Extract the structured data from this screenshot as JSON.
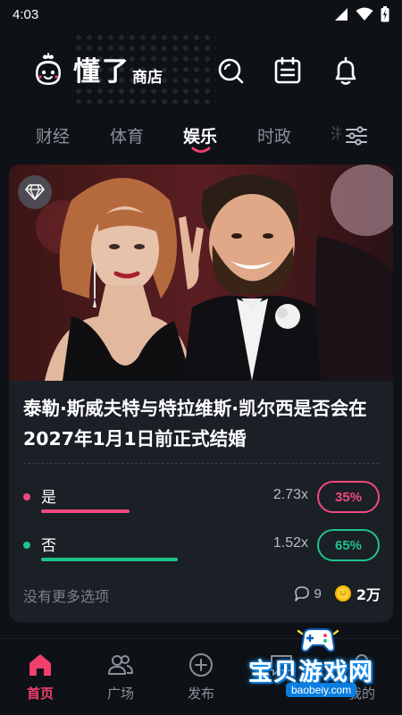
{
  "status_bar": {
    "time": "4:03"
  },
  "header": {
    "logo_text": "懂了",
    "logo_subtext": "商店"
  },
  "tabs": [
    {
      "label": "财经",
      "active": false
    },
    {
      "label": "体育",
      "active": false
    },
    {
      "label": "娱乐",
      "active": true
    },
    {
      "label": "时政",
      "active": false
    },
    {
      "label": "",
      "active": false
    }
  ],
  "card": {
    "title": "泰勒·斯威夫特与特拉维斯·凯尔西是否会在2027年1月1日前正式结婚",
    "options": [
      {
        "label": "是",
        "odds": "2.73x",
        "percent": "35%",
        "fraction": 0.35,
        "color": "#ef4a7c"
      },
      {
        "label": "否",
        "odds": "1.52x",
        "percent": "65%",
        "fraction": 0.65,
        "color": "#1fc28a"
      }
    ],
    "footer": {
      "no_more": "没有更多选项",
      "comments": "9",
      "coins": "2万"
    }
  },
  "nav": [
    {
      "label": "首页",
      "icon": "home-icon",
      "active": true
    },
    {
      "label": "广场",
      "icon": "people-icon",
      "active": false
    },
    {
      "label": "发布",
      "icon": "plus-circle-icon",
      "active": false
    },
    {
      "label": "",
      "icon": "message-icon",
      "active": false
    },
    {
      "label": "我的",
      "icon": "profile-icon",
      "active": false
    }
  ],
  "watermark": {
    "text": "宝贝游戏网",
    "url": "baobeiy.com"
  },
  "colors": {
    "accent": "#f0406e",
    "yes": "#ef4a7c",
    "no": "#1fc28a",
    "background": "#0e1116",
    "card": "#1b1f26"
  }
}
